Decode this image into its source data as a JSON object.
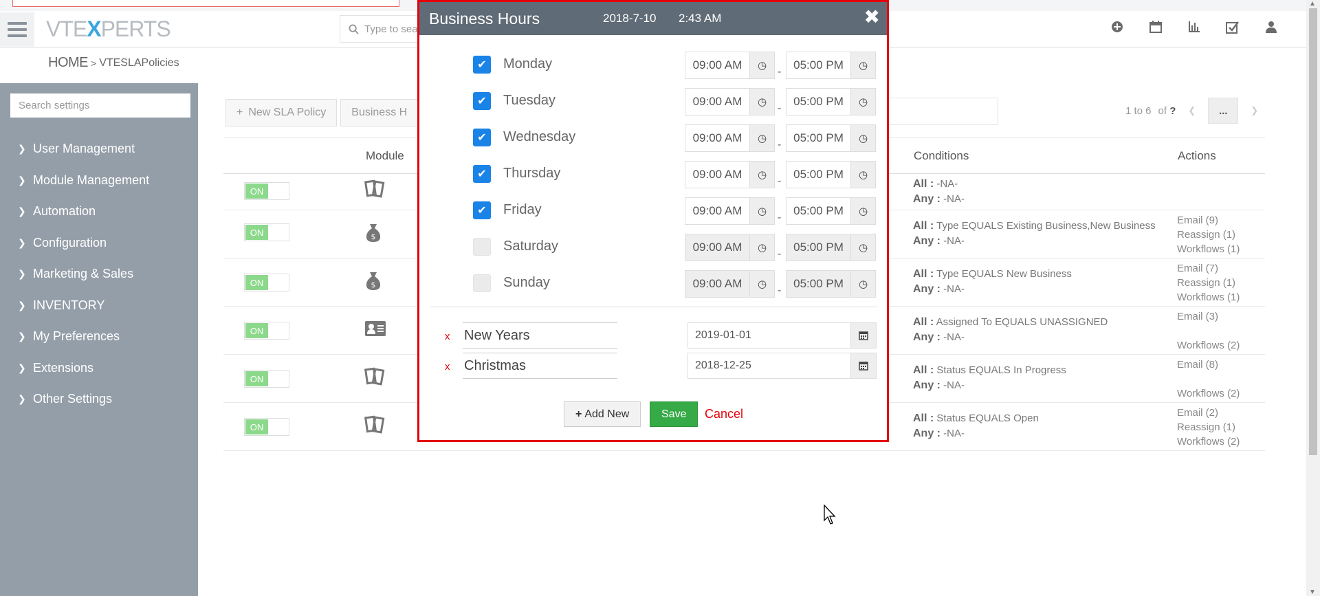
{
  "header": {
    "logo_pre": "VTE",
    "logo_x": "X",
    "logo_post": "PERTS",
    "search_placeholder": "Type to sea",
    "icons": [
      "plus-circle-icon",
      "calendar-icon",
      "bar-chart-icon",
      "checkbox-icon",
      "user-icon"
    ]
  },
  "breadcrumb": {
    "home": "HOME",
    "separator": ">",
    "current": "VTESLAPolicies"
  },
  "sidebar": {
    "search_placeholder": "Search settings",
    "items": [
      {
        "label": "User Management"
      },
      {
        "label": "Module Management"
      },
      {
        "label": "Automation"
      },
      {
        "label": "Configuration"
      },
      {
        "label": "Marketing & Sales"
      },
      {
        "label": "INVENTORY"
      },
      {
        "label": "My Preferences"
      },
      {
        "label": "Extensions"
      },
      {
        "label": "Other Settings"
      }
    ]
  },
  "toolbar": {
    "new_policy": "New SLA Policy",
    "business_hours": "Business H"
  },
  "pager": {
    "range": "1 to 6",
    "of": "of",
    "total": "?",
    "more": "..."
  },
  "table": {
    "headers": {
      "module": "Module",
      "conditions": "Conditions",
      "actions": "Actions"
    },
    "rows": [
      {
        "status": "ON",
        "icon": "tickets-icon",
        "all_label": "All :",
        "all": "-NA-",
        "any_label": "Any :",
        "any": "-NA-",
        "actions": [
          "",
          "",
          ""
        ]
      },
      {
        "status": "ON",
        "icon": "money-bag-icon",
        "all_label": "All :",
        "all": "Type EQUALS Existing Business,New Business",
        "any_label": "Any :",
        "any": "-NA-",
        "actions": [
          "Email (9)",
          "Reassign (1)",
          "Workflows (1)"
        ]
      },
      {
        "status": "ON",
        "icon": "money-bag-icon",
        "all_label": "All :",
        "all": "Type EQUALS New Business",
        "any_label": "Any :",
        "any": "-NA-",
        "actions": [
          "Email (7)",
          "Reassign (1)",
          "Workflows (1)"
        ]
      },
      {
        "status": "ON",
        "icon": "contact-card-icon",
        "all_label": "All :",
        "all": "Assigned To EQUALS UNASSIGNED",
        "any_label": "Any :",
        "any": "-NA-",
        "actions": [
          "Email (3)",
          "",
          "Workflows (2)"
        ]
      },
      {
        "status": "ON",
        "icon": "tickets-icon",
        "all_label": "All :",
        "all": "Status EQUALS In Progress",
        "any_label": "Any :",
        "any": "-NA-",
        "actions": [
          "Email (8)",
          "",
          "Workflows (2)"
        ]
      },
      {
        "status": "ON",
        "icon": "tickets-icon",
        "all_label": "All :",
        "all": "Status EQUALS Open",
        "any_label": "Any :",
        "any": "-NA-",
        "actions": [
          "Email (2)",
          "Reassign (1)",
          "Workflows (2)"
        ]
      }
    ]
  },
  "modal": {
    "title": "Business Hours",
    "date": "2018-7-10",
    "time": "2:43 AM",
    "close": "✖",
    "days": [
      {
        "name": "Monday",
        "checked": true,
        "start": "09:00 AM",
        "end": "05:00 PM"
      },
      {
        "name": "Tuesday",
        "checked": true,
        "start": "09:00 AM",
        "end": "05:00 PM"
      },
      {
        "name": "Wednesday",
        "checked": true,
        "start": "09:00 AM",
        "end": "05:00 PM"
      },
      {
        "name": "Thursday",
        "checked": true,
        "start": "09:00 AM",
        "end": "05:00 PM"
      },
      {
        "name": "Friday",
        "checked": true,
        "start": "09:00 AM",
        "end": "05:00 PM"
      },
      {
        "name": "Saturday",
        "checked": false,
        "start": "09:00 AM",
        "end": "05:00 PM"
      },
      {
        "name": "Sunday",
        "checked": false,
        "start": "09:00 AM",
        "end": "05:00 PM"
      }
    ],
    "dash": "-",
    "holidays": [
      {
        "remove": "x",
        "name": "New Years",
        "date": "2019-01-01"
      },
      {
        "remove": "x",
        "name": "Christmas",
        "date": "2018-12-25"
      }
    ],
    "add_new": "Add New",
    "save": "Save",
    "cancel": "Cancel"
  },
  "colors": {
    "modal_border": "#e3000b",
    "modal_header": "#5f6b76",
    "sidebar": "#949ea8",
    "checkbox_checked": "#1a83e8",
    "save_button": "#35aa47",
    "toggle_on": "#8cd98c"
  }
}
